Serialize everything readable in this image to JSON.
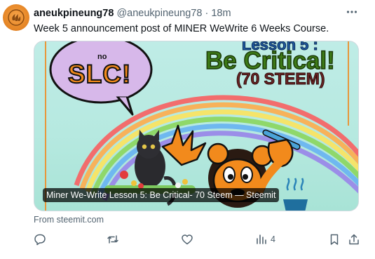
{
  "tweet": {
    "display_name": "aneukpineung78",
    "handle": "@aneukpineung78",
    "separator": "·",
    "time": "18m",
    "text": "Week 5 announcement post of MINER WeWrite 6 Weeks Course."
  },
  "card": {
    "bubble_small": "no",
    "bubble_big": "SLC!",
    "headline_top": "Lesson 5 :",
    "headline_main": "Be Critical!",
    "headline_sub": "(70 STEEM)",
    "link_title": "Miner We-Write Lesson 5: Be Critical- 70 Steem — Steemit",
    "source": "From steemit.com"
  },
  "actions": {
    "reply_icon": "reply-icon",
    "retweet_icon": "retweet-icon",
    "like_icon": "like-icon",
    "views_icon": "views-icon",
    "views_count": "4",
    "bookmark_icon": "bookmark-icon",
    "share_icon": "share-icon"
  },
  "colors": {
    "accent_text": "#0f1419",
    "muted_text": "#536471",
    "avatar_orange": "#e88a2a",
    "headline_green": "#2e5e12",
    "headline_maroon": "#5a1f1f"
  }
}
